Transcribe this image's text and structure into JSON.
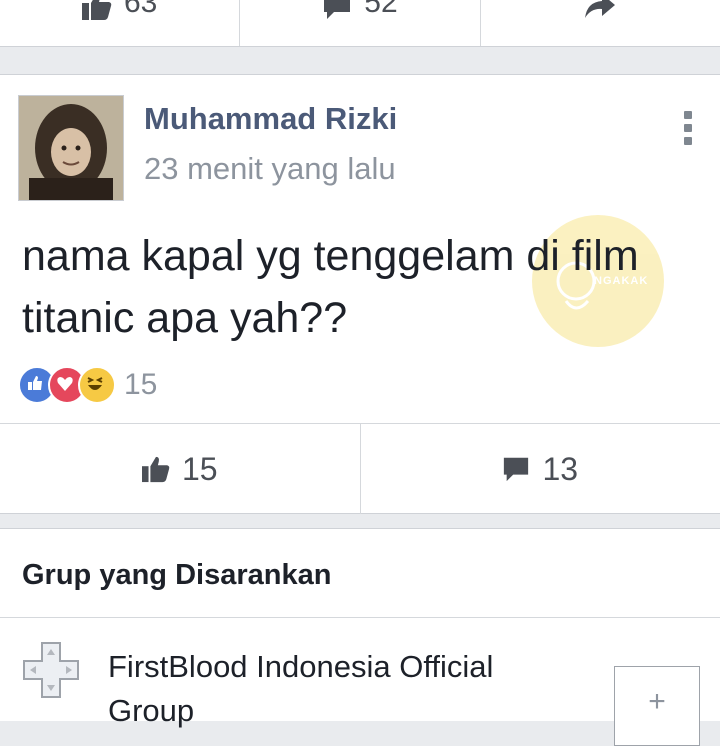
{
  "previous_post": {
    "like_count": "63",
    "comment_count": "52",
    "icons": {
      "like": "thumbs-up-icon",
      "comment": "comment-icon",
      "share": "share-icon"
    }
  },
  "post": {
    "author": "Muhammad Rizki",
    "time": "23 menit yang lalu",
    "text": "nama kapal yg tenggelam di film titanic apa yah??",
    "reaction_count": "15",
    "reactions": [
      "like-reaction-icon",
      "love-reaction-icon",
      "haha-reaction-icon"
    ],
    "like_count": "15",
    "comment_count": "13",
    "watermark_text": "NGAKAK"
  },
  "suggested_groups": {
    "title": "Grup yang Disarankan",
    "group_name": "FirstBlood Indonesia Official Group",
    "join_label": "+"
  },
  "colors": {
    "author_name": "#4b5a78",
    "timestamp": "#8d949e",
    "like_reaction": "#4b7bd8",
    "love_reaction": "#e5475c",
    "haha_reaction": "#f6c944",
    "page_background": "#e9ebee"
  }
}
